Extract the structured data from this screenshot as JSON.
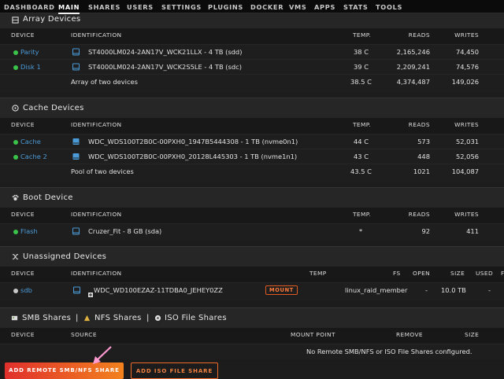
{
  "nav": {
    "tabs": [
      "DASHBOARD",
      "MAIN",
      "SHARES",
      "USERS",
      "SETTINGS",
      "PLUGINS",
      "DOCKER",
      "VMS",
      "APPS",
      "STATS",
      "TOOLS"
    ],
    "active": "MAIN"
  },
  "array": {
    "title": "Array Devices",
    "headers": {
      "device": "DEVICE",
      "identification": "IDENTIFICATION",
      "temp": "TEMP.",
      "reads": "READS",
      "writes": "WRITES"
    },
    "rows": [
      {
        "device": "Parity",
        "identification": "ST4000LM024-2AN17V_WCK21LLX - 4 TB (sdd)",
        "temp": "38 C",
        "reads": "2,165,246",
        "writes": "74,450"
      },
      {
        "device": "Disk 1",
        "identification": "ST4000LM024-2AN17V_WCK2S5LE - 4 TB (sdc)",
        "temp": "39 C",
        "reads": "2,209,241",
        "writes": "74,576"
      }
    ],
    "summary": {
      "label": "Array of two devices",
      "temp": "38.5 C",
      "reads": "4,374,487",
      "writes": "149,026"
    }
  },
  "cache": {
    "title": "Cache Devices",
    "headers": {
      "device": "DEVICE",
      "identification": "IDENTIFICATION",
      "temp": "TEMP.",
      "reads": "READS",
      "writes": "WRITES"
    },
    "rows": [
      {
        "device": "Cache",
        "identification": "WDC_WDS100T2B0C-00PXH0_1947B5444308 - 1 TB (nvme0n1)",
        "temp": "44 C",
        "reads": "573",
        "writes": "52,031"
      },
      {
        "device": "Cache 2",
        "identification": "WDC_WDS100T2B0C-00PXH0_20128L445303 - 1 TB (nvme1n1)",
        "temp": "43 C",
        "reads": "448",
        "writes": "52,056"
      }
    ],
    "summary": {
      "label": "Pool of two devices",
      "temp": "43.5 C",
      "reads": "1021",
      "writes": "104,087"
    }
  },
  "boot": {
    "title": "Boot Device",
    "headers": {
      "device": "DEVICE",
      "identification": "IDENTIFICATION",
      "temp": "TEMP.",
      "reads": "READS",
      "writes": "WRITES"
    },
    "row": {
      "device": "Flash",
      "identification": "Cruzer_Fit - 8 GB (sda)",
      "temp": "*",
      "reads": "92",
      "writes": "411"
    }
  },
  "unassigned": {
    "title": "Unassigned Devices",
    "headers": {
      "device": "DEVICE",
      "identification": "IDENTIFICATION",
      "temp": "TEMP",
      "fs": "FS",
      "open": "OPEN",
      "size": "SIZE",
      "used": "USED",
      "free": "F"
    },
    "row": {
      "device": "sdb",
      "identification": "WDC_WD100EZAZ-11TDBA0_JEHEY0ZZ",
      "mount": "MOUNT",
      "fs": "linux_raid_member",
      "open": "-",
      "size": "10.0 TB",
      "used": "-"
    }
  },
  "shares": {
    "title_smb": "SMB Shares",
    "title_nfs": "NFS Shares",
    "title_iso": "ISO File Shares",
    "sep": "|",
    "headers": {
      "device": "DEVICE",
      "source": "SOURCE",
      "mount_point": "MOUNT POINT",
      "remove": "REMOVE",
      "size": "SIZE"
    },
    "empty": "No Remote SMB/NFS or ISO File Shares configured."
  },
  "buttons": {
    "add_remote": "ADD REMOTE SMB/NFS SHARE",
    "add_iso": "ADD ISO FILE SHARE"
  },
  "colors": {
    "accent_orange": "#ee6b2a",
    "status_green": "#3ac24a",
    "device_link": "#4b9bd8"
  }
}
